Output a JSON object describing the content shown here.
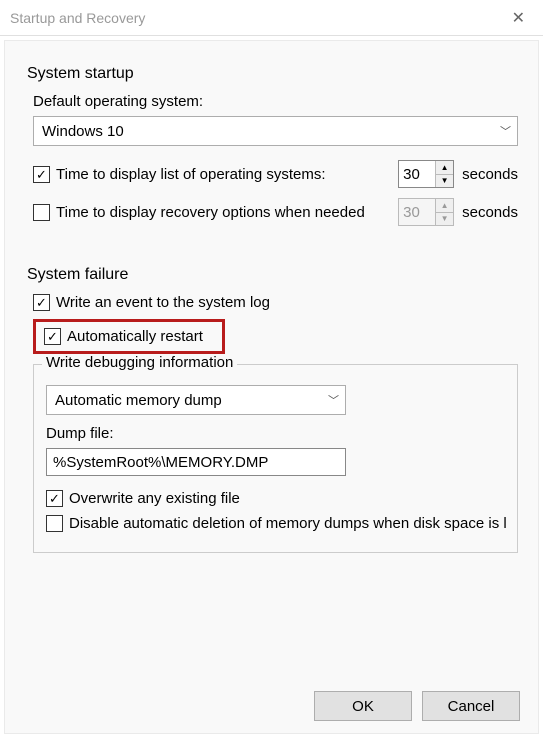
{
  "titlebar": {
    "title": "Startup and Recovery"
  },
  "startup": {
    "group_title": "System startup",
    "default_os_label": "Default operating system:",
    "default_os_value": "Windows 10",
    "display_list": {
      "checked": true,
      "label": "Time to display list of operating systems:",
      "value": "30",
      "unit": "seconds"
    },
    "display_recovery": {
      "checked": false,
      "label": "Time to display recovery options when needed",
      "value": "30",
      "unit": "seconds"
    }
  },
  "failure": {
    "group_title": "System failure",
    "write_event": {
      "checked": true,
      "label": "Write an event to the system log"
    },
    "auto_restart": {
      "checked": true,
      "label": "Automatically restart"
    },
    "debug_info": {
      "title": "Write debugging information",
      "dump_type": "Automatic memory dump",
      "dump_file_label": "Dump file:",
      "dump_file_value": "%SystemRoot%\\MEMORY.DMP",
      "overwrite": {
        "checked": true,
        "label": "Overwrite any existing file"
      },
      "disable_delete": {
        "checked": false,
        "label": "Disable automatic deletion of memory dumps when disk space is l"
      }
    }
  },
  "buttons": {
    "ok": "OK",
    "cancel": "Cancel"
  }
}
